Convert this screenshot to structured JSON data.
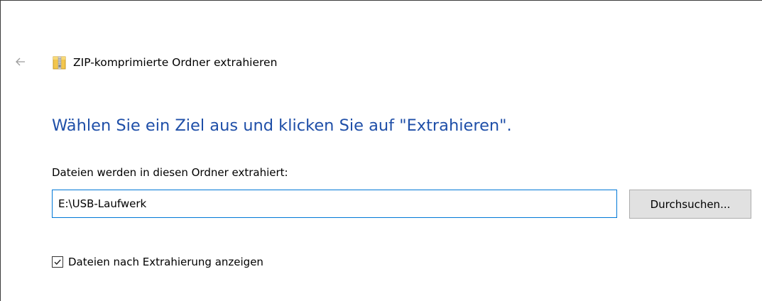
{
  "nav": {
    "back_icon": "arrow-left-icon"
  },
  "window": {
    "title": "ZIP-komprimierte Ordner extrahieren",
    "title_icon": "zip-folder-icon"
  },
  "main": {
    "heading": "Wählen Sie ein Ziel aus und klicken Sie auf \"Extrahieren\".",
    "folder_label": "Dateien werden in diesen Ordner extrahiert:",
    "path_value": "E:\\USB-Laufwerk",
    "browse_label": "Durchsuchen...",
    "show_files_label": "Dateien nach Extrahierung anzeigen",
    "show_files_checked": true
  },
  "colors": {
    "heading": "#1f4fa8",
    "input_focus_border": "#0078d7",
    "button_bg": "#e1e1e1"
  }
}
